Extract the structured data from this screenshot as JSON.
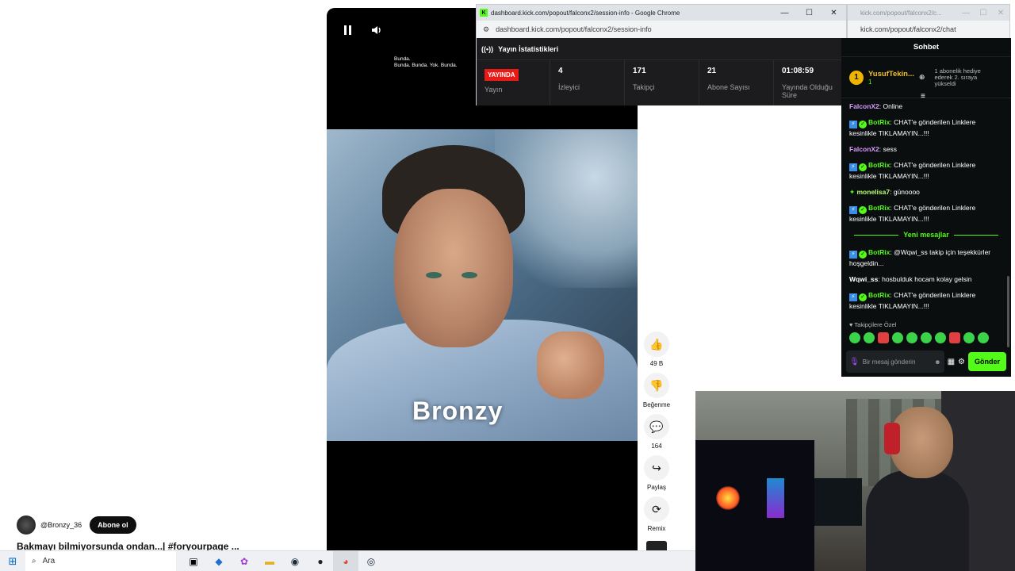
{
  "youtube": {
    "overlay_line1": "Bunda.",
    "overlay_line2": "Bunda. Bunda. Yok. Bunda.",
    "watermark": "Bronzy",
    "actions": {
      "like_count": "49 B",
      "dislike_label": "Beğenme",
      "comments_count": "164",
      "share_label": "Paylaş",
      "remix_label": "Remix"
    },
    "channel_name": "@Bronzy_36",
    "subscribe_label": "Abone ol",
    "title": "Bakmayı bilmiyorsunda ondan...| #foryourpage ..."
  },
  "stats_window": {
    "title": "dashboard.kick.com/popout/falconx2/session-info - Google Chrome",
    "url": "dashboard.kick.com/popout/falconx2/session-info",
    "header": "Yayın İstatistikleri",
    "live_badge": "YAYINDA",
    "stream_label": "Yayın",
    "stats": [
      {
        "value": "4",
        "label": "İzleyici"
      },
      {
        "value": "171",
        "label": "Takipçi"
      },
      {
        "value": "21",
        "label": "Abone Sayısı"
      },
      {
        "value": "01:08:59",
        "label": "Yayında Olduğu Süre"
      }
    ]
  },
  "chat_window": {
    "title": "kick.com/popout/falconx2/c...",
    "url": "kick.com/popout/falconx2/chat",
    "header": "Sohbet",
    "pinned_user": "YusufTekin...",
    "pinned_count": "1",
    "pinned_rank": "1",
    "pinned_sub_text": "1 abonelik hediye ederek 2. sıraya yükseldi",
    "messages": [
      {
        "user": "FalconX2",
        "text": "Online"
      },
      {
        "user": "BotRix",
        "text": "CHAT'e gönderilen Linklere kesinlikle TIKLAMAYIN...!!!"
      },
      {
        "user": "FalconX2",
        "text": "sess"
      },
      {
        "user": "BotRix",
        "text": "CHAT'e gönderilen Linklere kesinlikle TIKLAMAYIN...!!!"
      },
      {
        "user": "monelisa7",
        "text": "günoooo"
      },
      {
        "user": "BotRix",
        "text": "CHAT'e gönderilen Linklere kesinlikle TIKLAMAYIN...!!!"
      }
    ],
    "new_messages_label": "Yeni mesajlar",
    "new_messages": [
      {
        "user": "BotRix",
        "text": "@Wqwi_ss takip için teşekkürler hoşgeldin..."
      },
      {
        "user": "Wqwi_ss",
        "text": "hosbulduk hocam kolay gelsin"
      },
      {
        "user": "BotRix",
        "text": "CHAT'e gönderilen Linklere kesinlikle TIKLAMAYIN...!!!"
      }
    ],
    "followers_only_label": "Takipçilere Özel",
    "input_placeholder": "Bir mesaj gönderin",
    "send_label": "Gönder"
  },
  "taskbar": {
    "search_label": "Ara"
  },
  "colors": {
    "kick_green": "#53fc18",
    "live_red": "#e91916",
    "chat_bg": "#0b0e0f",
    "stats_bg": "#1c1c1e"
  }
}
